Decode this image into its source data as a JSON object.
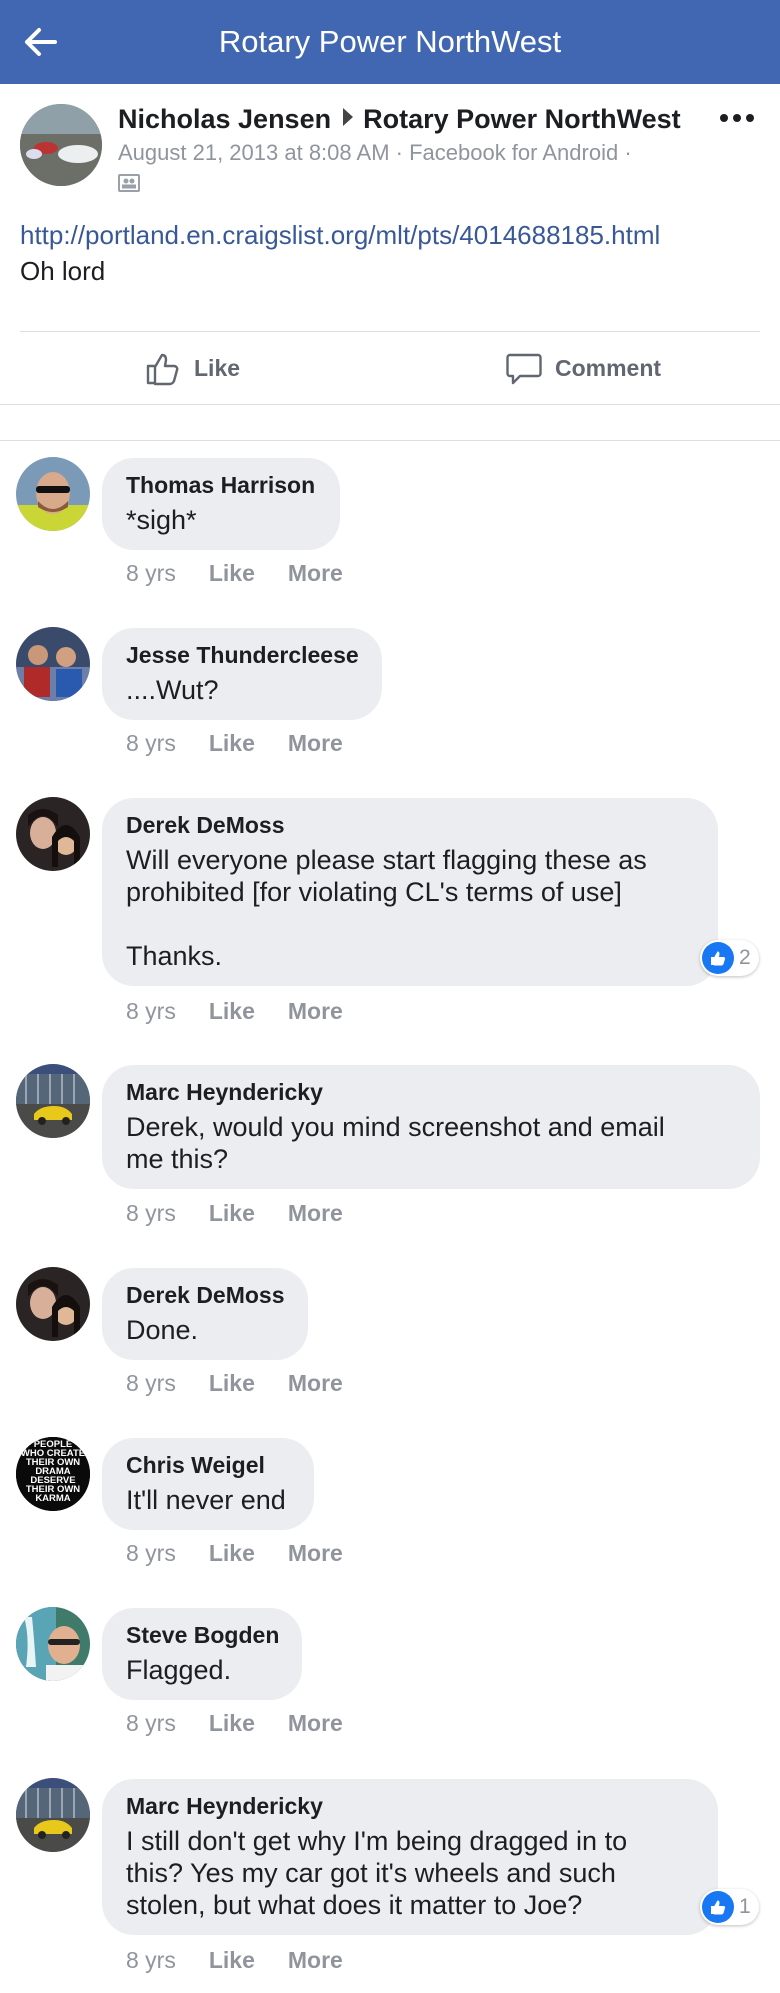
{
  "header": {
    "title": "Rotary Power NorthWest",
    "back_icon": "arrow-left-icon"
  },
  "post": {
    "author": "Nicholas Jensen",
    "target_group": "Rotary Power NorthWest",
    "timestamp": "August 21, 2013 at 8:08 AM · Facebook for Android ·",
    "link": "http://portland.en.craigslist.org/mlt/pts/4014688185.html",
    "text": "Oh lord",
    "like_label": "Like",
    "comment_label": "Comment"
  },
  "comments": [
    {
      "name": "Thomas Harrison",
      "body": "*sigh*",
      "age": "8 yrs",
      "like": "Like",
      "more": "More"
    },
    {
      "name": "Jesse Thundercleese",
      "body": "....Wut?",
      "age": "8 yrs",
      "like": "Like",
      "more": "More"
    },
    {
      "name": "Derek DeMoss",
      "body": "Will everyone please start flagging these as\nprohibited [for violating CL's terms of use]\n\nThanks.",
      "age": "8 yrs",
      "like": "Like",
      "more": "More",
      "reactions": "2"
    },
    {
      "name": "Marc Heyndericky",
      "body": "Derek, would you mind screenshot and email\nme this?",
      "age": "8 yrs",
      "like": "Like",
      "more": "More"
    },
    {
      "name": "Derek DeMoss",
      "body": "Done.",
      "age": "8 yrs",
      "like": "Like",
      "more": "More"
    },
    {
      "name": "Chris Weigel",
      "body": "It'll never end",
      "age": "8 yrs",
      "like": "Like",
      "more": "More"
    },
    {
      "name": "Steve Bogden",
      "body": "Flagged.",
      "age": "8 yrs",
      "like": "Like",
      "more": "More"
    },
    {
      "name": "Marc Heyndericky",
      "body": "I still don't get why I'm being dragged in to\nthis? Yes my car got it's wheels and such\nstolen, but what does it matter to Joe?",
      "age": "8 yrs",
      "like": "Like",
      "more": "More",
      "reactions": "1"
    }
  ],
  "avatar_badge_text": [
    "PEOPLE",
    "WHO CREATE",
    "THEIR OWN",
    "DRAMA",
    "DESERVE",
    "THEIR OWN",
    "KARMA"
  ],
  "colors": {
    "brand": "#4267b2",
    "link": "#385898",
    "bubble": "#ebedf0",
    "muted": "#90949c",
    "like_blue": "#1877f2"
  }
}
